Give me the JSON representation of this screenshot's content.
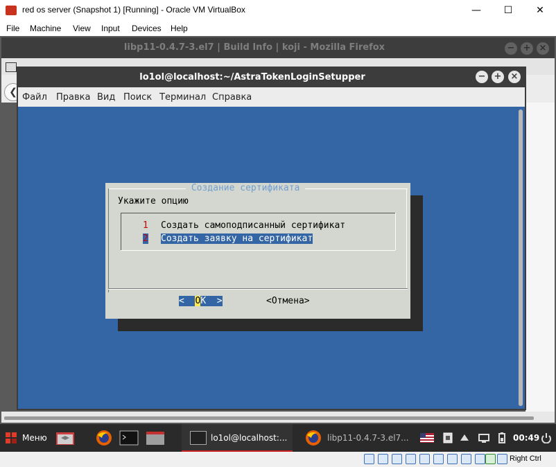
{
  "vbox": {
    "title": "red os server (Snapshot 1) [Running] - Oracle VM VirtualBox",
    "minimize_glyph": "—",
    "maximize_glyph": "☐",
    "close_glyph": "✕",
    "menu": [
      "File",
      "Machine",
      "View",
      "Input",
      "Devices",
      "Help"
    ],
    "host_key": "Right Ctrl"
  },
  "firefox": {
    "title": "libp11-0.4.7-3.el7 | Build Info | koji - Mozilla Firefox",
    "back_glyph": "❮",
    "buttons": [
      "−",
      "+",
      "×"
    ]
  },
  "terminal": {
    "title": "lo1ol@localhost:~/AstraTokenLoginSetupper",
    "buttons": [
      "−",
      "+",
      "×"
    ],
    "menu": [
      "Файл",
      "Правка",
      "Вид",
      "Поиск",
      "Терминал",
      "Справка"
    ]
  },
  "dialog": {
    "title": " Создание сертификата ",
    "prompt": "Укажите опцию",
    "items": [
      {
        "tag": "1",
        "label": "Создать самоподписанный сертификат"
      },
      {
        "tag": "2",
        "label": "Создать заявку на сертификат"
      }
    ],
    "ok_prefix": "<  ",
    "ok_hot": "O",
    "ok_rest": "K  >",
    "cancel": "<Отмена>"
  },
  "taskbar": {
    "start_label": "Меню",
    "task1_label": "lo1ol@localhost:...",
    "task2_label": "libp11-0.4.7-3.el7...",
    "clock": "00:49"
  },
  "colors": {
    "terminal_bg": "#3465a4",
    "dialog_bg": "#d3d7cf",
    "dialog_title": "#729fcf",
    "tag_red": "#cc0000",
    "hotkey_yellow": "#fce94f"
  }
}
